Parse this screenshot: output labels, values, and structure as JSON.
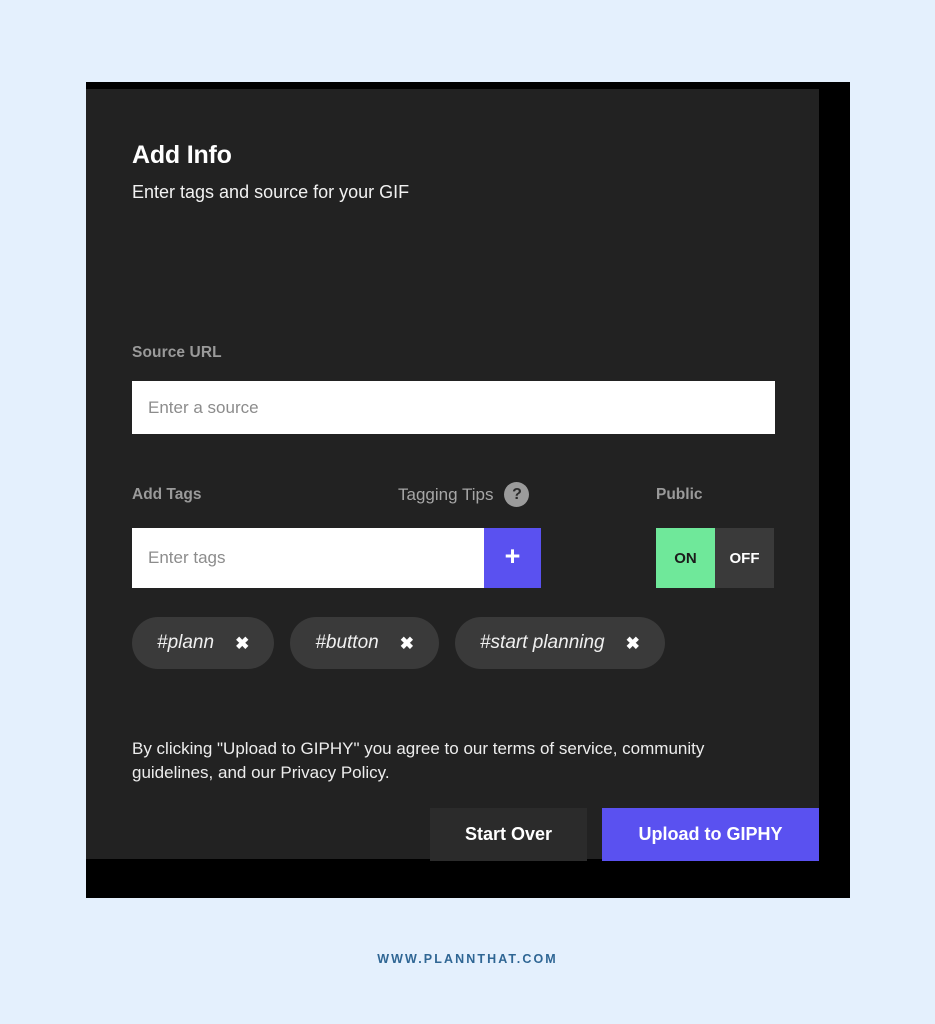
{
  "page": {
    "background_color": "#e4f0fd",
    "watermark": "WWW.PLANNTHAT.COM"
  },
  "modal": {
    "title": "Add Info",
    "subtitle": "Enter tags and source for your GIF",
    "frame_color": "#000000",
    "body_color": "#222222",
    "source": {
      "label": "Source URL",
      "value": "",
      "placeholder": "Enter a source"
    },
    "tags": {
      "label": "Add Tags",
      "tips_label": "Tagging Tips",
      "help_icon": "question-mark-icon",
      "help_glyph": "?",
      "value": "",
      "placeholder": "Enter tags",
      "add_button_icon": "plus-icon",
      "add_button_glyph": "+",
      "add_button_color": "#5a51f0",
      "chips": [
        {
          "text": "#plann",
          "remove_glyph": "✖"
        },
        {
          "text": "#button",
          "remove_glyph": "✖"
        },
        {
          "text": "#start planning",
          "remove_glyph": "✖"
        }
      ]
    },
    "public": {
      "label": "Public",
      "on_label": "ON",
      "off_label": "OFF",
      "selected": "ON",
      "on_color": "#6fe89a",
      "off_color": "#3a3a3a"
    },
    "legal": "By clicking \"Upload to GIPHY\" you agree to our terms of service, community guidelines, and our Privacy Policy.",
    "footer": {
      "start_over_label": "Start Over",
      "upload_label": "Upload to GIPHY",
      "upload_color": "#5a51f0"
    }
  }
}
